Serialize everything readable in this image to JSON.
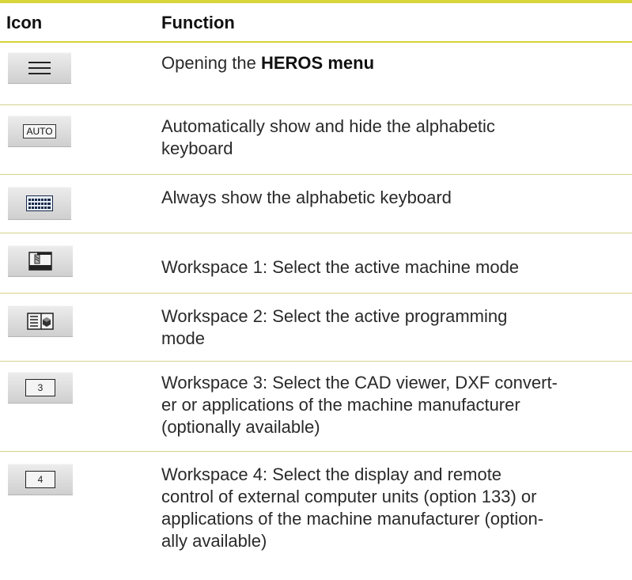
{
  "header": {
    "icon_col": "Icon",
    "function_col": "Function"
  },
  "rows": [
    {
      "icon": "hamburger-menu-icon",
      "pre": "Opening the ",
      "bold": "HEROS menu",
      "post": ""
    },
    {
      "icon": "auto-keyboard-icon",
      "icon_text": "AUTO",
      "line1": "Automatically show and hide the alphabetic",
      "line2": "keyboard"
    },
    {
      "icon": "keyboard-icon",
      "line1": "Always show the alphabetic keyboard"
    },
    {
      "icon": "machine-mode-icon",
      "line1": "Workspace 1: Select the active machine mode"
    },
    {
      "icon": "programming-mode-icon",
      "line1": "Workspace 2: Select the active programming",
      "line2": "mode"
    },
    {
      "icon": "workspace-3-icon",
      "icon_text": "3",
      "line1": "Workspace 3: Select the CAD viewer, DXF convert-",
      "line2": "er or applications of the machine manufacturer",
      "line3": "(optionally available)"
    },
    {
      "icon": "workspace-4-icon",
      "icon_text": "4",
      "line1": "Workspace 4: Select the display and remote",
      "line2": "control of external computer units (option 133) or",
      "line3": "applications of the machine manufacturer (option-",
      "line4": "ally available)"
    }
  ],
  "colors": {
    "rule": "#d8d43a",
    "text": "#2a2a2a",
    "button_top": "#ececec",
    "button_bottom": "#cfcfcf"
  }
}
